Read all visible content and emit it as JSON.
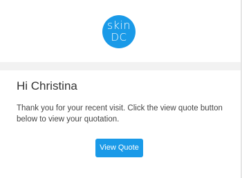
{
  "logo": {
    "line1": "skin",
    "line2": "DC",
    "color": "#1a9ae8"
  },
  "email": {
    "greeting": "Hi Christina",
    "message": "Thank you for your recent visit. Click the view quote button below to view your quotation.",
    "button_label": "View Quote",
    "button_color": "#1a9ae8"
  }
}
